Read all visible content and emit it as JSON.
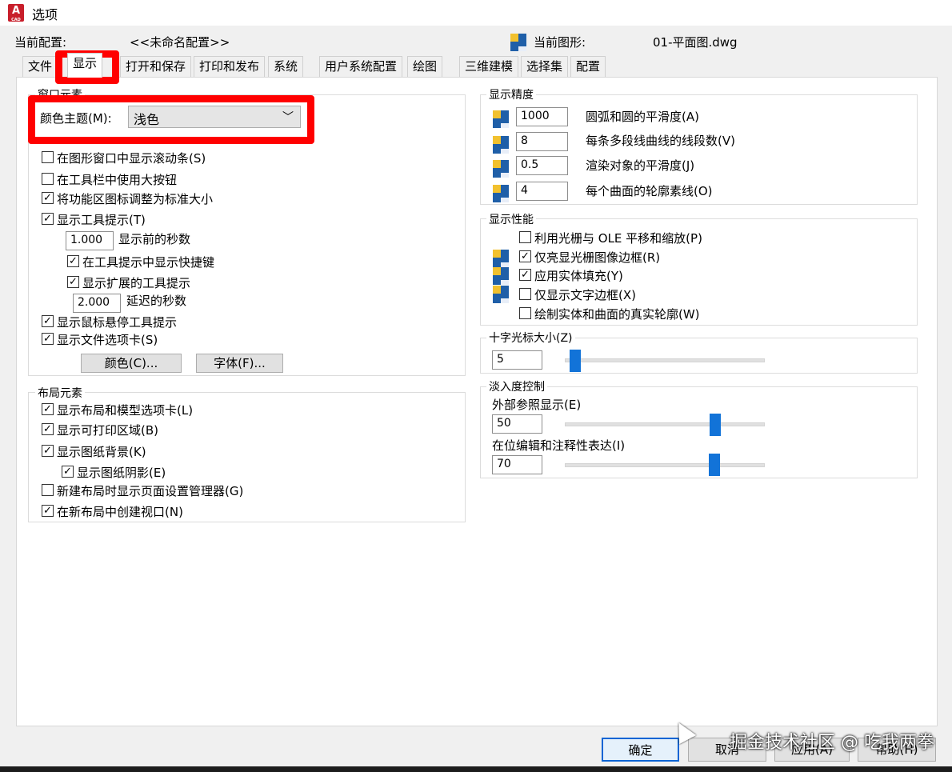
{
  "window": {
    "title": "选项",
    "app_icon_letter": "A",
    "app_icon_sub": "CAD"
  },
  "config": {
    "current_profile_label": "当前配置:",
    "current_profile_value": "<<未命名配置>>",
    "current_drawing_label": "当前图形:",
    "current_drawing_value": "01-平面图.dwg"
  },
  "tabs": [
    "文件",
    "显示",
    "打开和保存",
    "打印和发布",
    "系统",
    "用户系统配置",
    "绘图",
    "三维建模",
    "选择集",
    "配置"
  ],
  "active_tab": "显示",
  "window_elements": {
    "title": "窗口元素",
    "color_theme_label": "颜色主题(M):",
    "color_theme_value": "浅色",
    "options": [
      {
        "label": "在图形窗口中显示滚动条(S)",
        "checked": false
      },
      {
        "label": "在工具栏中使用大按钮",
        "checked": false
      },
      {
        "label": "将功能区图标调整为标准大小",
        "checked": true
      },
      {
        "label": "显示工具提示(T)",
        "checked": true
      }
    ],
    "tooltip_delay_value": "1.000",
    "tooltip_delay_label": "显示前的秒数",
    "show_shortcut_label": "在工具提示中显示快捷键",
    "show_shortcut_checked": true,
    "show_extended_label": "显示扩展的工具提示",
    "show_extended_checked": true,
    "extended_delay_value": "2.000",
    "extended_delay_label": "延迟的秒数",
    "rollover_label": "显示鼠标悬停工具提示",
    "rollover_checked": true,
    "file_tabs_label": "显示文件选项卡(S)",
    "file_tabs_checked": true,
    "colors_button": "颜色(C)...",
    "fonts_button": "字体(F)..."
  },
  "layout_elements": {
    "title": "布局元素",
    "options": [
      {
        "label": "显示布局和模型选项卡(L)",
        "checked": true
      },
      {
        "label": "显示可打印区域(B)",
        "checked": true
      },
      {
        "label": "显示图纸背景(K)",
        "checked": true
      },
      {
        "label": "显示图纸阴影(E)",
        "checked": true
      },
      {
        "label": "新建布局时显示页面设置管理器(G)",
        "checked": false
      },
      {
        "label": "在新布局中创建视口(N)",
        "checked": true
      }
    ]
  },
  "display_resolution": {
    "title": "显示精度",
    "rows": [
      {
        "value": "1000",
        "label": "圆弧和圆的平滑度(A)"
      },
      {
        "value": "8",
        "label": "每条多段线曲线的线段数(V)"
      },
      {
        "value": "0.5",
        "label": "渲染对象的平滑度(J)"
      },
      {
        "value": "4",
        "label": "每个曲面的轮廓素线(O)"
      }
    ]
  },
  "display_performance": {
    "title": "显示性能",
    "options": [
      {
        "label": "利用光栅与 OLE 平移和缩放(P)",
        "checked": false
      },
      {
        "label": "仅亮显光栅图像边框(R)",
        "checked": true
      },
      {
        "label": "应用实体填充(Y)",
        "checked": true
      },
      {
        "label": "仅显示文字边框(X)",
        "checked": false
      },
      {
        "label": "绘制实体和曲面的真实轮廓(W)",
        "checked": false
      }
    ]
  },
  "crosshair": {
    "title": "十字光标大小(Z)",
    "value": "5",
    "level_percent": 5
  },
  "fade_control": {
    "title": "淡入度控制",
    "xref_label": "外部参照显示(E)",
    "xref_value": "50",
    "xref_level_percent": 50,
    "inplace_label": "在位编辑和注释性表达(I)",
    "inplace_value": "70",
    "inplace_level_percent": 70
  },
  "buttons": {
    "ok": "确定",
    "cancel": "取消",
    "apply": "应用(A)",
    "help": "帮助(H)"
  },
  "watermark": "掘金技术社区 @ 吃我两拳",
  "colors": {
    "highlight": "#ff0000",
    "slider": "#1273d8",
    "icon_blue": "#1f5fa8",
    "icon_yellow": "#f2c12e"
  }
}
